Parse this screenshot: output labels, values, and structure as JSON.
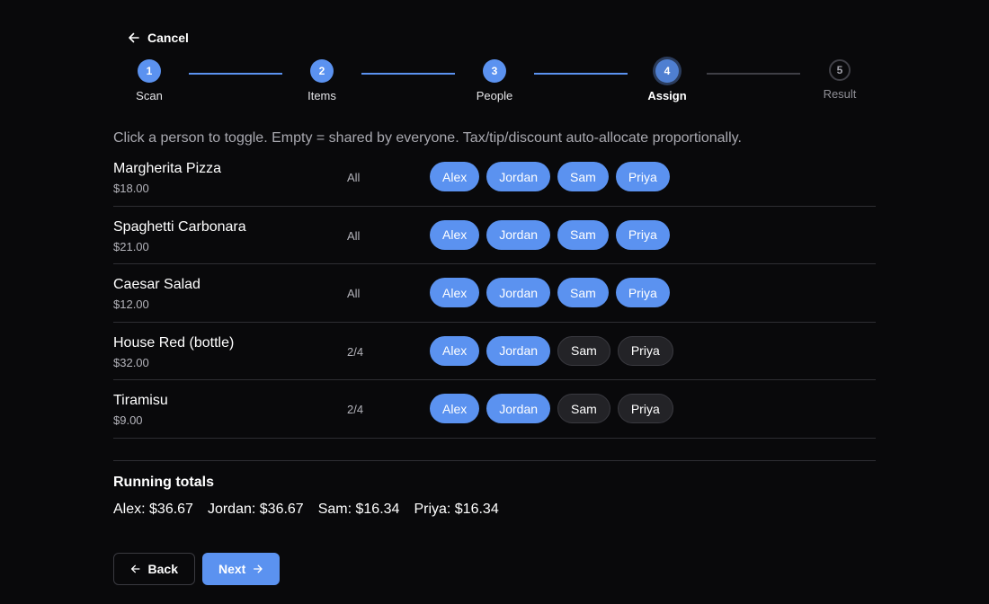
{
  "nav": {
    "cancel_label": "Cancel"
  },
  "steps": [
    {
      "num": "1",
      "label": "Scan",
      "state": "done"
    },
    {
      "num": "2",
      "label": "Items",
      "state": "done"
    },
    {
      "num": "3",
      "label": "People",
      "state": "done"
    },
    {
      "num": "4",
      "label": "Assign",
      "state": "active"
    },
    {
      "num": "5",
      "label": "Result",
      "state": "todo"
    }
  ],
  "hint": "Click a person to toggle. Empty = shared by everyone. Tax/tip/discount auto-allocate proportionally.",
  "people": [
    "Alex",
    "Jordan",
    "Sam",
    "Priya"
  ],
  "items": [
    {
      "name": "Margherita Pizza",
      "price": "$18.00",
      "share": "All",
      "assigned": [
        true,
        true,
        true,
        true
      ]
    },
    {
      "name": "Spaghetti Carbonara",
      "price": "$21.00",
      "share": "All",
      "assigned": [
        true,
        true,
        true,
        true
      ]
    },
    {
      "name": "Caesar Salad",
      "price": "$12.00",
      "share": "All",
      "assigned": [
        true,
        true,
        true,
        true
      ]
    },
    {
      "name": "House Red (bottle)",
      "price": "$32.00",
      "share": "2/4",
      "assigned": [
        true,
        true,
        false,
        false
      ]
    },
    {
      "name": "Tiramisu",
      "price": "$9.00",
      "share": "2/4",
      "assigned": [
        true,
        true,
        false,
        false
      ]
    }
  ],
  "totals": {
    "title": "Running totals",
    "entries": [
      "Alex: $36.67",
      "Jordan: $36.67",
      "Sam: $16.34",
      "Priya: $16.34"
    ]
  },
  "footer": {
    "back_label": "Back",
    "next_label": "Next"
  },
  "colors": {
    "accent": "#5b92f0",
    "background": "#09090b",
    "chip_off": "#232327"
  }
}
